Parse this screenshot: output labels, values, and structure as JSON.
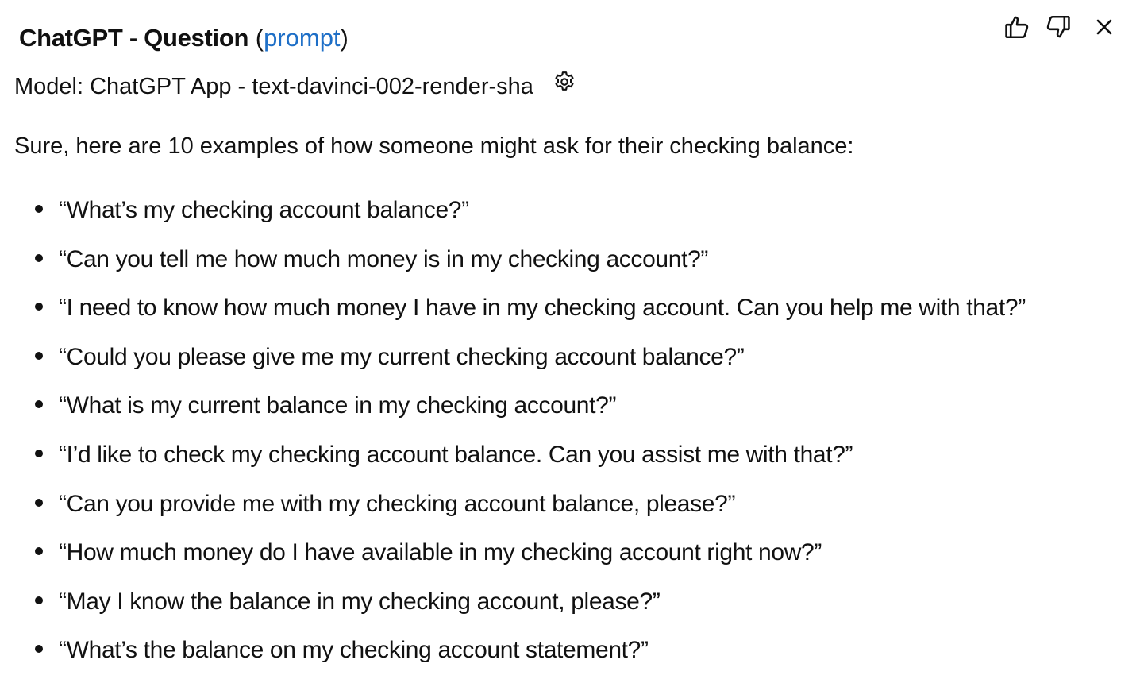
{
  "header": {
    "title": "ChatGPT - Question",
    "open_paren": "(",
    "link": "prompt",
    "close_paren": ")",
    "link_color": "#1e6fc7"
  },
  "actions": {
    "thumbs_up_icon": "thumbs-up-icon",
    "thumbs_down_icon": "thumbs-down-icon",
    "close_icon": "close-icon"
  },
  "model": {
    "text": "Model: ChatGPT App - text-davinci-002-render-sha",
    "settings_icon": "gear-icon"
  },
  "response": {
    "intro": "Sure, here are 10 examples of how someone might ask for their checking balance:",
    "items": [
      "“What’s my checking account balance?”",
      "“Can you tell me how much money is in my checking account?”",
      "“I need to know how much money I have in my checking account. Can you help me with that?”",
      "“Could you please give me my current checking account balance?”",
      "“What is my current balance in my checking account?”",
      "“I’d like to check my checking account balance. Can you assist me with that?”",
      "“Can you provide me with my checking account balance, please?”",
      "“How much money do I have available in my checking account right now?”",
      "“May I know the balance in my checking account, please?”",
      "“What’s the balance on my checking account statement?”"
    ]
  }
}
